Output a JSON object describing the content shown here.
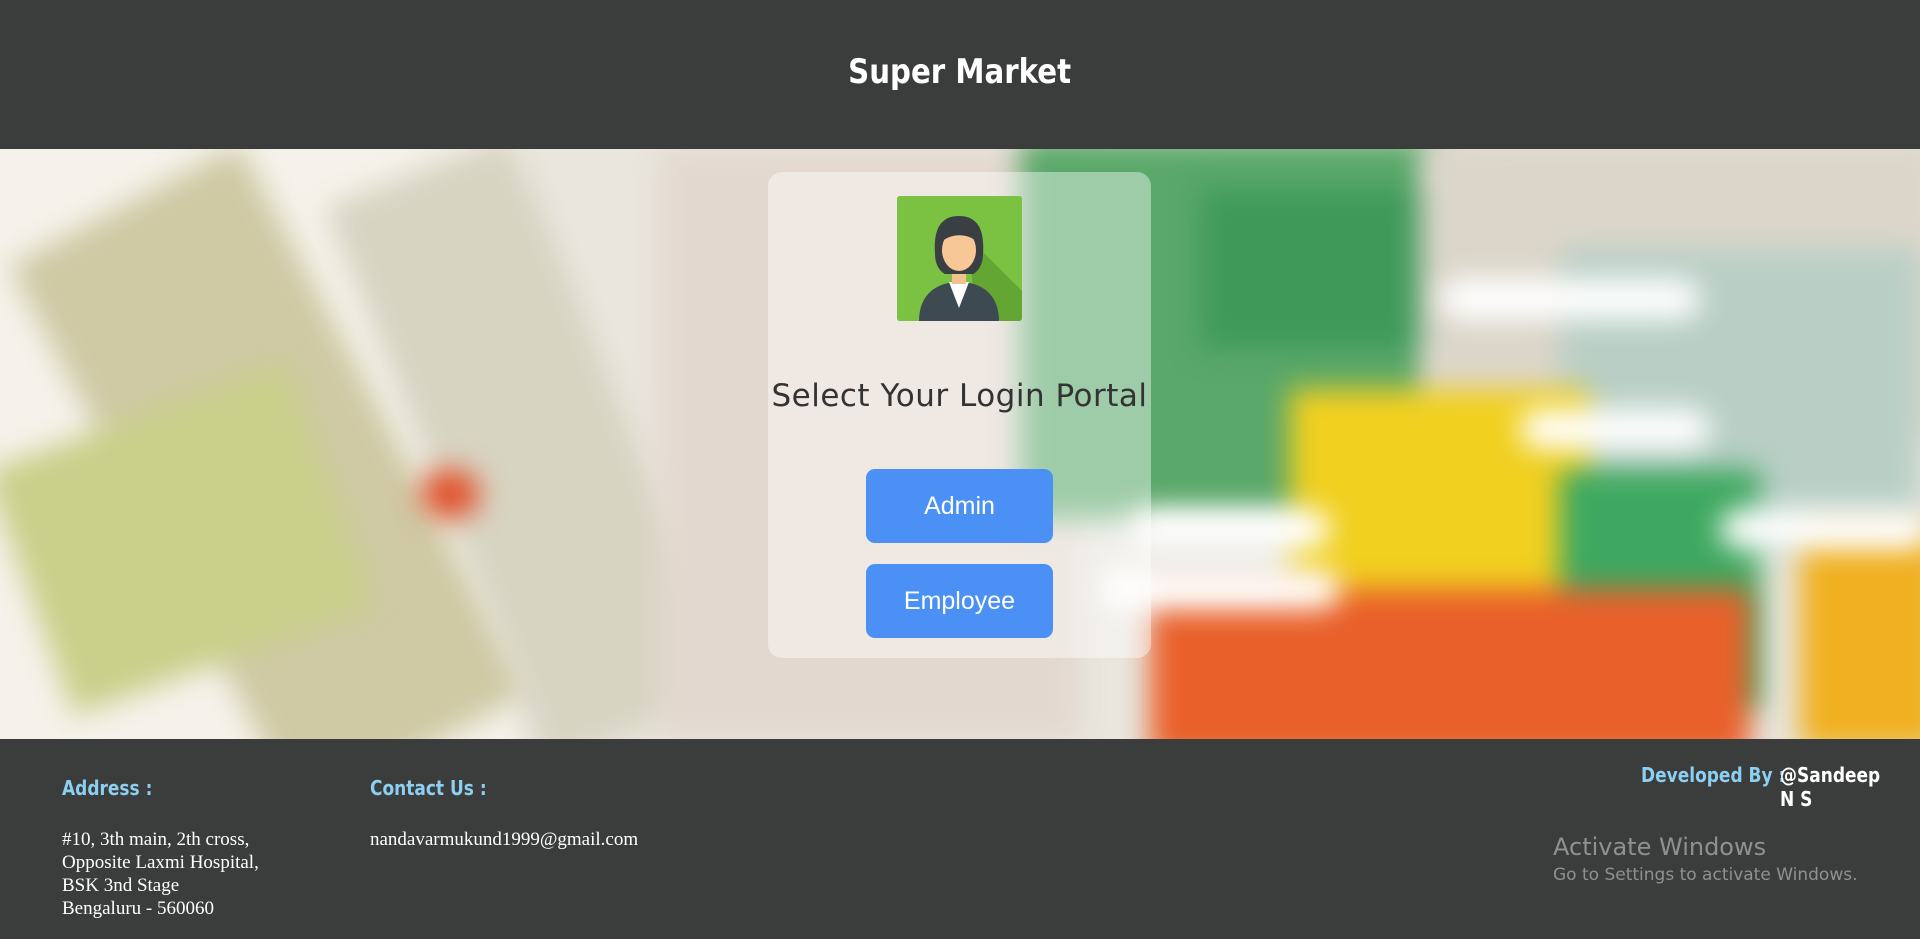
{
  "header": {
    "title": "Super Market"
  },
  "login": {
    "title": "Select Your Login Portal",
    "admin_label": "Admin",
    "employee_label": "Employee"
  },
  "footer": {
    "address_heading": "Address :",
    "address_lines": [
      "#10, 3th main, 2th cross,",
      "Opposite Laxmi Hospital,",
      "BSK 3nd Stage",
      "Bengaluru - 560060"
    ],
    "contact_heading": "Contact Us :",
    "contact_email": "nandavarmukund1999@gmail.com",
    "developed_heading": "Developed By :",
    "developer": "@Sandeep N S"
  },
  "watermark": {
    "title": "Activate Windows",
    "subtitle": "Go to Settings to activate Windows."
  },
  "colors": {
    "background": "#3b3c3c",
    "accent_button": "#4a90f5",
    "footer_heading": "#8ccff0"
  },
  "icons": {
    "avatar": "female-user-avatar-icon"
  }
}
